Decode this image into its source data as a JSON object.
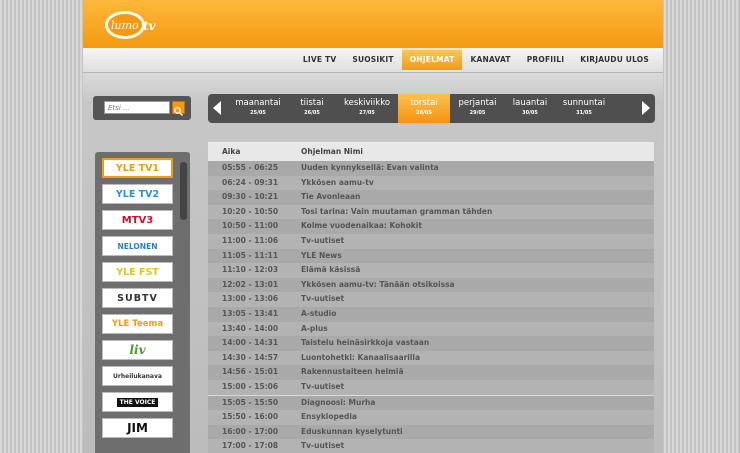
{
  "logo": {
    "text": "lumo tv"
  },
  "nav": {
    "items": [
      "LIVE TV",
      "SUOSIKIT",
      "OHJELMAT",
      "KANAVAT",
      "PROFIILI",
      "KIRJAUDU ULOS"
    ],
    "active_index": 2
  },
  "search": {
    "placeholder": "Etsi ..."
  },
  "days": [
    {
      "day": "maanantai",
      "date": "25/05"
    },
    {
      "day": "tiistai",
      "date": "26/05"
    },
    {
      "day": "keskiviikko",
      "date": "27/05"
    },
    {
      "day": "torstai",
      "date": "28/05"
    },
    {
      "day": "perjantai",
      "date": "29/05"
    },
    {
      "day": "lauantai",
      "date": "30/05"
    },
    {
      "day": "sunnuntai",
      "date": "31/05"
    }
  ],
  "active_day_index": 3,
  "channels": [
    "YLE TV1",
    "YLE TV2",
    "MTV3",
    "NELONEN",
    "YLE FST",
    "SUBTV",
    "YLE Teema",
    "liv",
    "Urheilukanava",
    "THE VOICE",
    "JIM"
  ],
  "active_channel_index": 0,
  "schedule": {
    "col_time": "Aika",
    "col_name": "Ohjelman Nimi",
    "rows": [
      {
        "time": "05:55 - 06:25",
        "name": "Uuden kynnyksellä: Evan valinta"
      },
      {
        "time": "06:24 - 09:31",
        "name": "Ykkösen aamu-tv"
      },
      {
        "time": "09:30 - 10:21",
        "name": "Tie Avonleaan"
      },
      {
        "time": "10:20 - 10:50",
        "name": "Tosi tarina: Vain muutaman gramman tähden"
      },
      {
        "time": "10:50 - 11:00",
        "name": "Kolme vuodenaikaa: Kohokit"
      },
      {
        "time": "11:00 - 11:06",
        "name": "Tv-uutiset"
      },
      {
        "time": "11:05 - 11:11",
        "name": "YLE News"
      },
      {
        "time": "11:10 - 12:03",
        "name": "Elämä käsissä"
      },
      {
        "time": "12:02 - 13:01",
        "name": "Ykkösen aamu-tv: Tänään otsikoissa"
      },
      {
        "time": "13:00 - 13:06",
        "name": "Tv-uutiset"
      },
      {
        "time": "13:05 - 13:41",
        "name": "A-studio"
      },
      {
        "time": "13:40 - 14:00",
        "name": "A-plus"
      },
      {
        "time": "14:00 - 14:31",
        "name": "Taistelu heinäsirkkoja vastaan"
      },
      {
        "time": "14:30 - 14:57",
        "name": "Luontohetki: Kanaalisaarilla"
      },
      {
        "time": "14:56 - 15:01",
        "name": "Rakennustaiteen helmiä"
      },
      {
        "time": "15:00 - 15:06",
        "name": "Tv-uutiset"
      },
      {
        "time": "15:05 - 15:50",
        "name": "Diagnoosi: Murha"
      },
      {
        "time": "15:50 - 16:00",
        "name": "Ensyklopedia"
      },
      {
        "time": "16:00 - 17:00",
        "name": "Eduskunnan kyselytunti"
      },
      {
        "time": "17:00 - 17:08",
        "name": "Tv-uutiset"
      }
    ]
  }
}
